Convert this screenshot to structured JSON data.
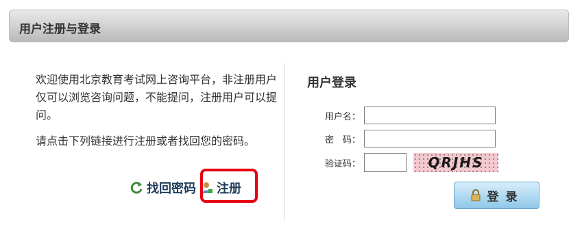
{
  "header": {
    "title": "用户注册与登录"
  },
  "intro": {
    "paragraph1": "欢迎使用北京教育考试网上咨询平台，非注册用户仅可以浏览咨询问题，不能提问，注册用户可以提问。",
    "paragraph2": "请点击下列链接进行注册或者找回您的密码。"
  },
  "links": {
    "recover_password": "找回密码",
    "register": "注册"
  },
  "login": {
    "title": "用户登录",
    "username_label": "用户名：",
    "password_label": "密　码：",
    "captcha_label": "验证码：",
    "captcha_text": "QRJHS",
    "submit_label": "登录"
  },
  "colors": {
    "highlight": "#e60012",
    "link": "#1f3d5a",
    "button": "#8fc8e8"
  },
  "icons": [
    "refresh-arrow-icon",
    "user-icon",
    "lock-icon"
  ]
}
